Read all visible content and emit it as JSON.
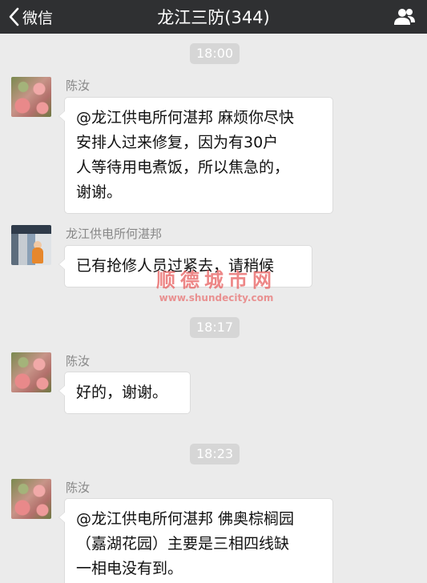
{
  "nav": {
    "back_label": "微信",
    "title": "龙江三防(344)",
    "icons": {
      "back": "chevron-left-icon",
      "members": "group-members-icon"
    }
  },
  "colors": {
    "nav_bg": "#2f3032",
    "chat_bg": "#ebebeb",
    "bubble_bg": "#ffffff",
    "timestamp_bg": "#d6d6d6",
    "watermark": "#e86464"
  },
  "messages": [
    {
      "time": "18:00",
      "sender": "陈汝",
      "avatar": "apple-avatar",
      "lines": [
        "@龙江供电所何湛邦 麻烦你尽快",
        "安排人过来修复，因为有30户",
        "人等待用电煮饭，所以焦急的，",
        "谢谢。"
      ]
    },
    {
      "sender": "龙江供电所何湛邦",
      "avatar": "photo-avatar",
      "lines": [
        "已有抢修人员过紧去，请稍候"
      ]
    },
    {
      "time": "18:17",
      "sender": "陈汝",
      "avatar": "apple-avatar",
      "lines": [
        "好的，谢谢。"
      ]
    },
    {
      "time": "18:23",
      "sender": "陈汝",
      "avatar": "apple-avatar",
      "lines": [
        "@龙江供电所何湛邦 佛奥棕榈园",
        "（嘉湖花园）主要是三相四线缺",
        "一相电没有到。"
      ]
    }
  ],
  "watermark": {
    "text": "顺德城市网",
    "url": "www.shundecity.com"
  }
}
